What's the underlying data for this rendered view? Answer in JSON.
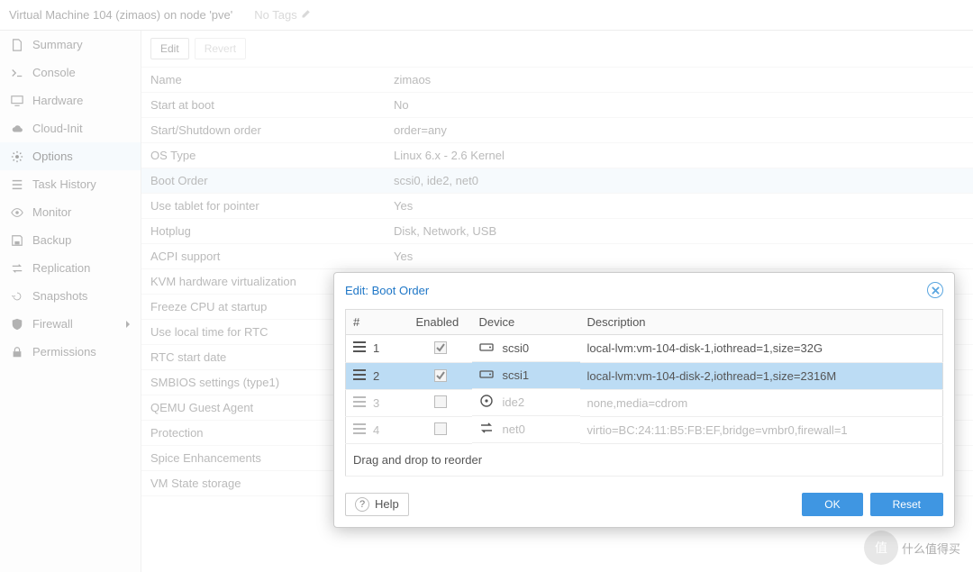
{
  "header": {
    "title": "Virtual Machine 104 (zimaos) on node 'pve'",
    "no_tags": "No Tags"
  },
  "sidebar": {
    "items": [
      {
        "label": "Summary",
        "icon": "file"
      },
      {
        "label": "Console",
        "icon": "terminal"
      },
      {
        "label": "Hardware",
        "icon": "desktop"
      },
      {
        "label": "Cloud-Init",
        "icon": "cloud"
      },
      {
        "label": "Options",
        "icon": "gear",
        "selected": true
      },
      {
        "label": "Task History",
        "icon": "list"
      },
      {
        "label": "Monitor",
        "icon": "eye"
      },
      {
        "label": "Backup",
        "icon": "save"
      },
      {
        "label": "Replication",
        "icon": "exchange"
      },
      {
        "label": "Snapshots",
        "icon": "history"
      },
      {
        "label": "Firewall",
        "icon": "shield",
        "chevron": true
      },
      {
        "label": "Permissions",
        "icon": "lock"
      }
    ]
  },
  "toolbar": {
    "edit_label": "Edit",
    "revert_label": "Revert"
  },
  "options": {
    "rows": [
      {
        "key": "Name",
        "value": "zimaos"
      },
      {
        "key": "Start at boot",
        "value": "No"
      },
      {
        "key": "Start/Shutdown order",
        "value": "order=any"
      },
      {
        "key": "OS Type",
        "value": "Linux 6.x - 2.6 Kernel"
      },
      {
        "key": "Boot Order",
        "value": "scsi0, ide2, net0",
        "selected": true
      },
      {
        "key": "Use tablet for pointer",
        "value": "Yes"
      },
      {
        "key": "Hotplug",
        "value": "Disk, Network, USB"
      },
      {
        "key": "ACPI support",
        "value": "Yes"
      },
      {
        "key": "KVM hardware virtualization",
        "value": ""
      },
      {
        "key": "Freeze CPU at startup",
        "value": ""
      },
      {
        "key": "Use local time for RTC",
        "value": ""
      },
      {
        "key": "RTC start date",
        "value": ""
      },
      {
        "key": "SMBIOS settings (type1)",
        "value": ""
      },
      {
        "key": "QEMU Guest Agent",
        "value": ""
      },
      {
        "key": "Protection",
        "value": ""
      },
      {
        "key": "Spice Enhancements",
        "value": ""
      },
      {
        "key": "VM State storage",
        "value": ""
      }
    ]
  },
  "dialog": {
    "title": "Edit: Boot Order",
    "columns": {
      "order": "#",
      "enabled": "Enabled",
      "device": "Device",
      "description": "Description"
    },
    "rows": [
      {
        "order": "1",
        "enabled": true,
        "device": "scsi0",
        "icon": "hdd",
        "description": "local-lvm:vm-104-disk-1,iothread=1,size=32G"
      },
      {
        "order": "2",
        "enabled": true,
        "device": "scsi1",
        "icon": "hdd",
        "description": "local-lvm:vm-104-disk-2,iothread=1,size=2316M",
        "selected": true
      },
      {
        "order": "3",
        "enabled": false,
        "device": "ide2",
        "icon": "cd",
        "description": "none,media=cdrom"
      },
      {
        "order": "4",
        "enabled": false,
        "device": "net0",
        "icon": "net",
        "description": "virtio=BC:24:11:B5:FB:EF,bridge=vmbr0,firewall=1"
      }
    ],
    "hint": "Drag and drop to reorder",
    "help_label": "Help",
    "ok_label": "OK",
    "reset_label": "Reset"
  },
  "watermark": {
    "text": "什么值得买",
    "short": "值"
  }
}
